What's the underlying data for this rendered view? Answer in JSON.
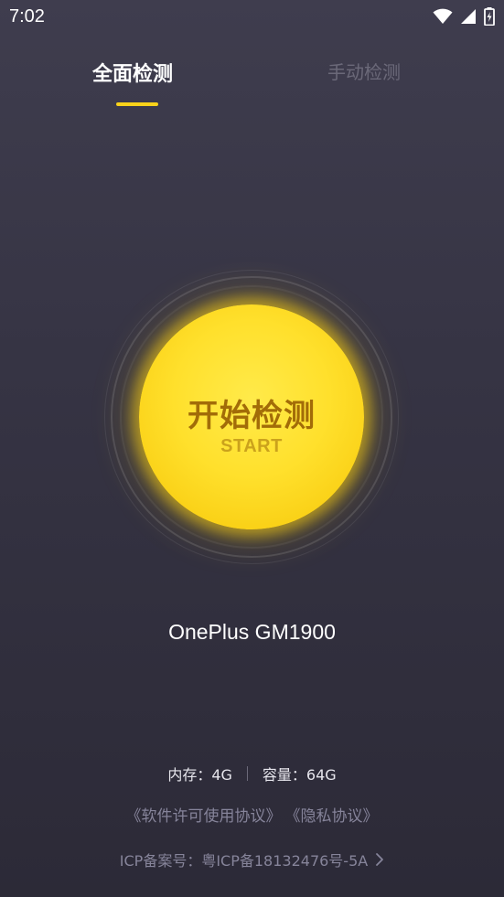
{
  "status_bar": {
    "time": "7:02",
    "icons": [
      "wifi-icon",
      "signal-icon",
      "battery-charging-icon"
    ]
  },
  "tabs": [
    {
      "label": "全面检测",
      "active": true
    },
    {
      "label": "手动检测",
      "active": false
    }
  ],
  "start_button": {
    "title": "开始检测",
    "subtitle": "START"
  },
  "device": {
    "name": "OnePlus GM1900"
  },
  "specs": {
    "memory": "内存：4G",
    "storage": "容量：64G"
  },
  "agreements": {
    "license": "《软件许可使用协议》",
    "privacy": "《隐私协议》"
  },
  "icp": {
    "text": "ICP备案号：粤ICP备18132476号-5A"
  },
  "colors": {
    "accent": "#f9d21a",
    "background_top": "#3f3d4e",
    "background_bottom": "#2c2a37",
    "inactive_text": "#6b6979"
  }
}
